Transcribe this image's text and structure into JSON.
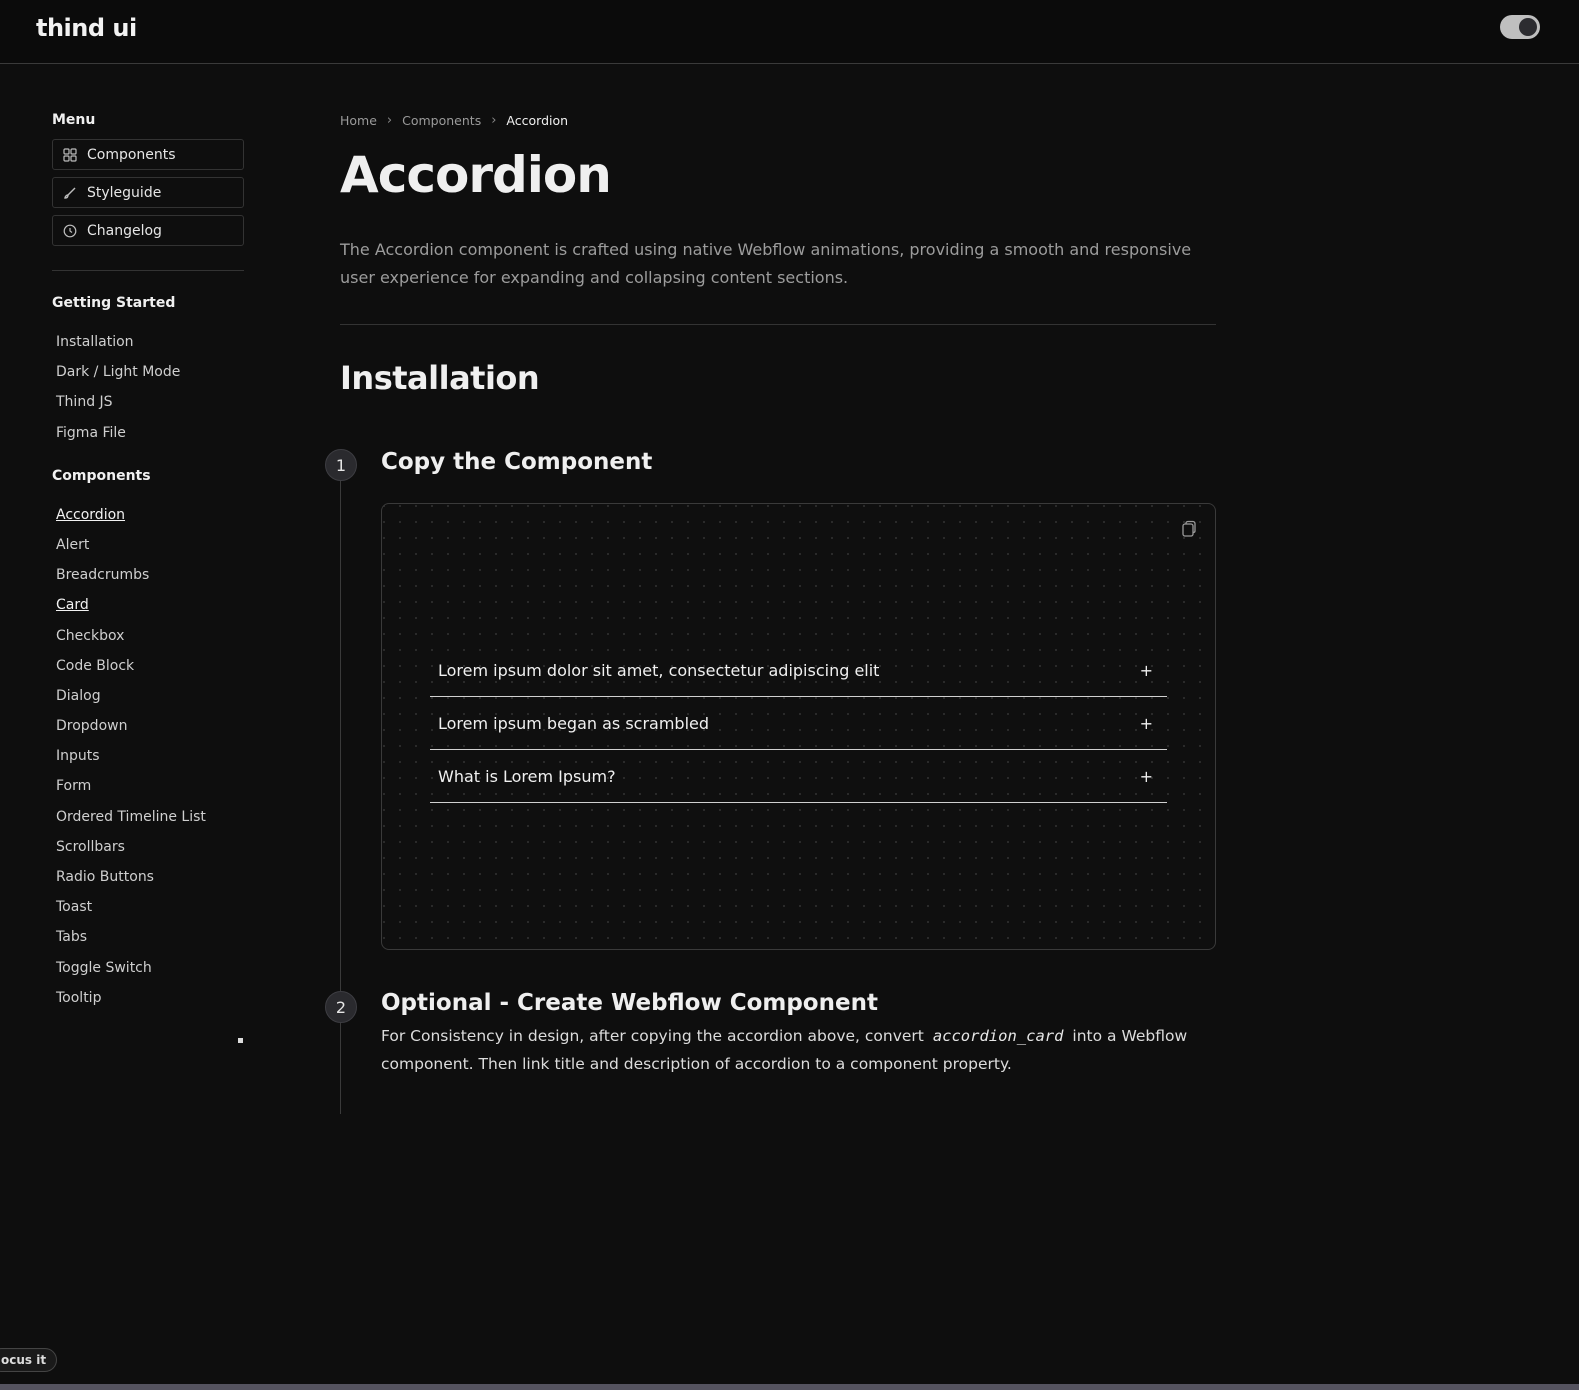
{
  "header": {
    "logo": "thind ui",
    "theme_toggle": "on"
  },
  "sidebar": {
    "menu_heading": "Menu",
    "menu_items": [
      {
        "label": "Components",
        "icon": "grid-icon"
      },
      {
        "label": "Styleguide",
        "icon": "brush-icon"
      },
      {
        "label": "Changelog",
        "icon": "clock-icon"
      }
    ],
    "getting_started_heading": "Getting Started",
    "getting_started": [
      "Installation",
      "Dark / Light Mode",
      "Thind JS",
      "Figma File"
    ],
    "components_heading": "Components",
    "components": [
      "Accordion",
      "Alert",
      "Breadcrumbs",
      "Card",
      "Checkbox",
      "Code Block",
      "Dialog",
      "Dropdown",
      "Inputs",
      "Form",
      "Ordered Timeline List",
      "Scrollbars",
      "Radio Buttons",
      "Toast",
      "Tabs",
      "Toggle Switch",
      "Tooltip"
    ]
  },
  "breadcrumb": {
    "home": "Home",
    "components": "Components",
    "current": "Accordion"
  },
  "page": {
    "title": "Accordion",
    "lead": "The Accordion component is crafted using native Webflow animations, providing a smooth and responsive user experience for expanding and collapsing content sections.",
    "installation_heading": "Installation"
  },
  "steps": [
    {
      "number": "1",
      "title": "Copy the Component"
    },
    {
      "number": "2",
      "title": "Optional - Create Webflow Component"
    }
  ],
  "accordion": [
    {
      "question": "Lorem ipsum dolor sit amet, consectetur adipiscing elit",
      "icon": "+"
    },
    {
      "question": "Lorem ipsum began as scrambled",
      "icon": "+"
    },
    {
      "question": "What is Lorem Ipsum?",
      "icon": "+"
    }
  ],
  "step2": {
    "text_before": "For Consistency in design, after copying the accordion above, convert",
    "code": "accordion_card",
    "text_after": "into a Webflow component. Then link title and description of accordion to a component property."
  },
  "focus_pill": "ocus it"
}
